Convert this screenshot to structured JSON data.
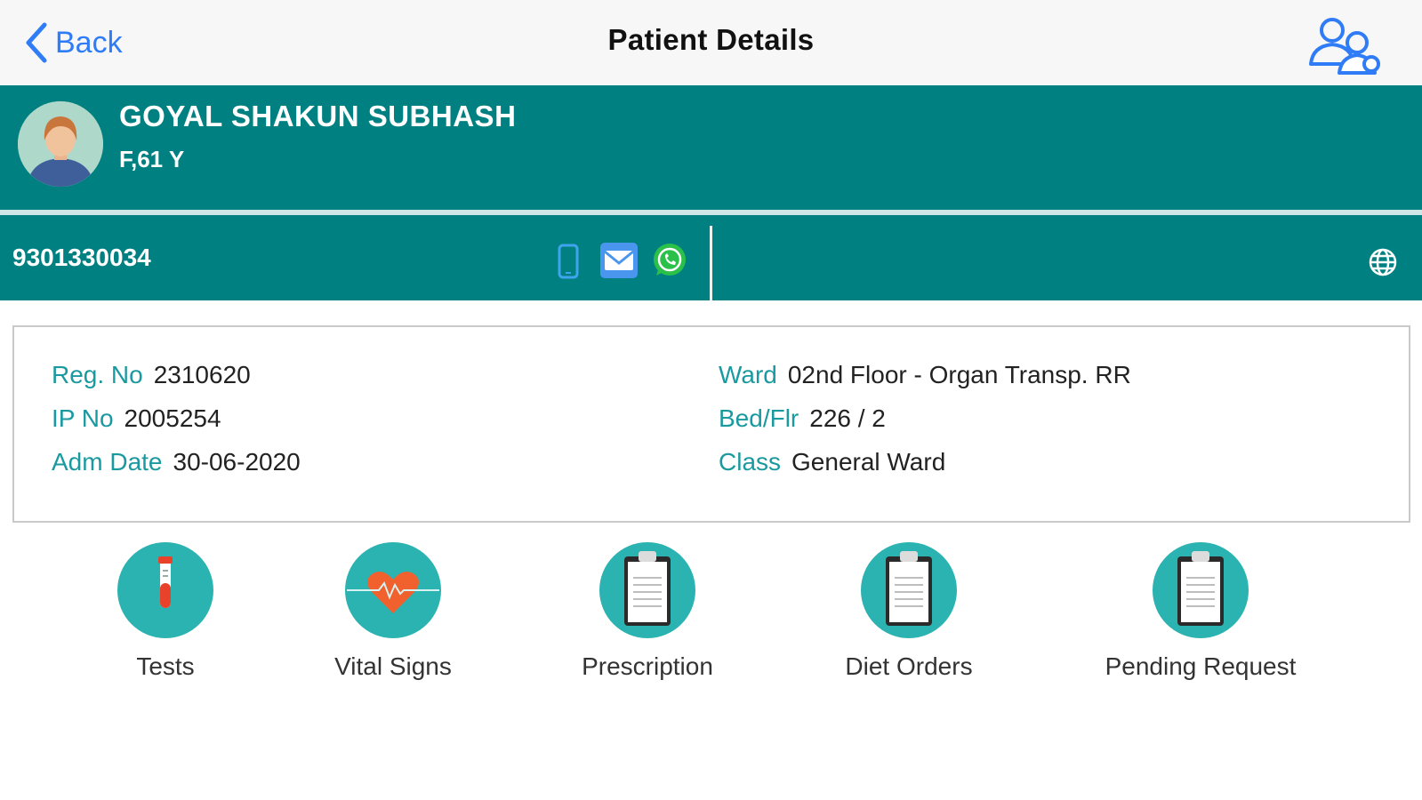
{
  "nav": {
    "back_label": "Back",
    "title": "Patient Details",
    "right_icon": "users-icon"
  },
  "patient": {
    "name": "GOYAL SHAKUN SUBHASH",
    "gender_age": "F,61 Y",
    "avatar_icon": "female-avatar"
  },
  "contact": {
    "phone": "9301330034",
    "icons": [
      "mobile-phone-icon",
      "email-icon",
      "whatsapp-icon",
      "globe-icon"
    ]
  },
  "info": {
    "left": [
      {
        "label": "Reg. No",
        "value": "2310620"
      },
      {
        "label": "IP No",
        "value": "2005254"
      },
      {
        "label": "Adm Date",
        "value": "30-06-2020"
      }
    ],
    "right": [
      {
        "label": "Ward",
        "value": "02nd Floor - Organ Transp. RR"
      },
      {
        "label": "Bed/Flr",
        "value": "226 / 2"
      },
      {
        "label": "Class",
        "value": "General Ward"
      }
    ]
  },
  "actions": [
    {
      "label": "Tests",
      "icon": "test-tube-icon"
    },
    {
      "label": "Vital Signs",
      "icon": "heart-pulse-icon"
    },
    {
      "label": "Prescription",
      "icon": "clipboard-icon"
    },
    {
      "label": "Diet Orders",
      "icon": "clipboard-icon"
    },
    {
      "label": "Pending Request",
      "icon": "clipboard-icon"
    }
  ],
  "colors": {
    "teal": "#008080",
    "accent_label": "#1a9aa0",
    "icon_circle": "#2bb3b1",
    "ios_blue": "#2f7cf6"
  }
}
